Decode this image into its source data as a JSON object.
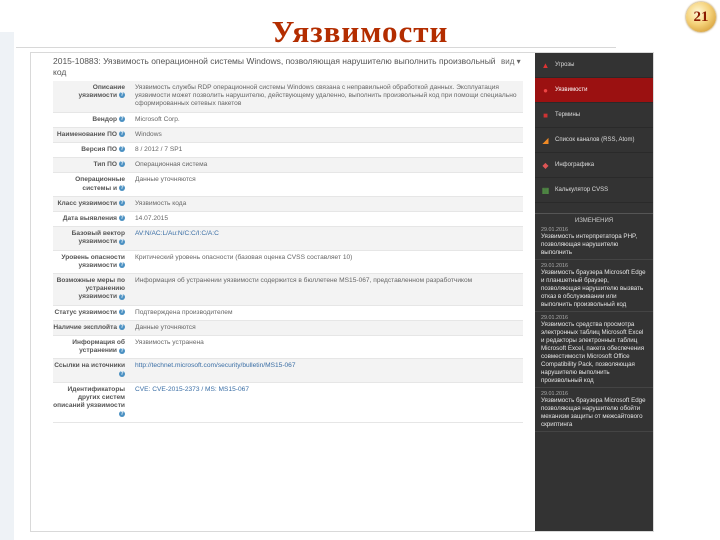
{
  "slide": {
    "title": "Уязвимости",
    "page_number": "21"
  },
  "header": {
    "vuln_title": "2015-10883: Уязвимость операционной системы Windows, позволяющая нарушителю выполнить произвольный код",
    "dropdown": "вид ▾"
  },
  "rows": [
    {
      "label": "Описание уязвимости",
      "value": "Уязвимость службы RDP операционной системы Windows связана с неправильной обработкой данных. Эксплуатация уязвимости может позволить нарушителю, действующему удаленно, выполнить произвольный код при помощи специально сформированных сетевых пакетов"
    },
    {
      "label": "Вендор",
      "value": "Microsoft Corp."
    },
    {
      "label": "Наименование ПО",
      "value": "Windows"
    },
    {
      "label": "Версия ПО",
      "value": "8 / 2012 / 7 SP1"
    },
    {
      "label": "Тип ПО",
      "value": "Операционная система"
    },
    {
      "label": "Операционные системы и",
      "value": "Данные уточняются"
    },
    {
      "label": "Класс уязвимости",
      "value": "Уязвимость кода"
    },
    {
      "label": "Дата выявления",
      "value": "14.07.2015"
    },
    {
      "label": "Базовый вектор уязвимости",
      "value": "AV:N/AC:L/Au:N/C:C/I:C/A:C",
      "link": true
    },
    {
      "label": "Уровень опасности уязвимости",
      "value": "Критический уровень опасности (базовая оценка CVSS составляет 10)"
    },
    {
      "label": "Возможные меры по устранению уязвимости",
      "value": "Информация об устранении уязвимости содержится в бюллетене MS15-067, представленном разработчиком"
    },
    {
      "label": "Статус уязвимости",
      "value": "Подтверждена производителем"
    },
    {
      "label": "Наличие эксплойта",
      "value": "Данные уточняются"
    },
    {
      "label": "Информация об устранении",
      "value": "Уязвимость устранена"
    },
    {
      "label": "Ссылки на источники",
      "value": "http://technet.microsoft.com/security/bulletin/MS15-067",
      "link": true
    },
    {
      "label": "Идентификаторы других систем описаний уязвимости",
      "value": "CVE: CVE-2015-2373 / MS: MS15-067",
      "link": true
    }
  ],
  "sidebar": {
    "menu": [
      {
        "label": "Угрозы",
        "icon": "warning-icon"
      },
      {
        "label": "Уязвимости",
        "icon": "bug-icon",
        "active": true
      },
      {
        "label": "Термины",
        "icon": "book-icon"
      },
      {
        "label": "Список каналов (RSS, Atom)",
        "icon": "rss-icon"
      },
      {
        "label": "Инфографика",
        "icon": "chart-icon"
      },
      {
        "label": "Калькулятор CVSS",
        "icon": "calculator-icon"
      }
    ],
    "changes_heading": "ИЗМЕНЕНИЯ",
    "news": [
      {
        "date": "29.01.2016",
        "text": "Уязвимость интерпретатора PHP, позволяющая нарушителю выполнить"
      },
      {
        "date": "29.01.2016",
        "text": "Уязвимость браузера Microsoft Edge и планшетный браузер, позволяющая нарушителю вызвать отказ в обслуживании или выполнить произвольный код"
      },
      {
        "date": "29.01.2016",
        "text": "Уязвимость средства просмотра электронных таблиц Microsoft Excel и редакторы электронных таблиц Microsoft Excel, пакета обеспечения совместимости Microsoft Office Compatibility Pack, позволяющая нарушителю выполнить произвольный код"
      },
      {
        "date": "29.01.2016",
        "text": "Уязвимость браузера Microsoft Edge позволяющая нарушителю обойти механизм защиты от межсайтового скриптинга"
      }
    ]
  },
  "colors": {
    "title": "#b32d00",
    "sidebar_bg": "#333333",
    "active_item": "#9b1111"
  }
}
